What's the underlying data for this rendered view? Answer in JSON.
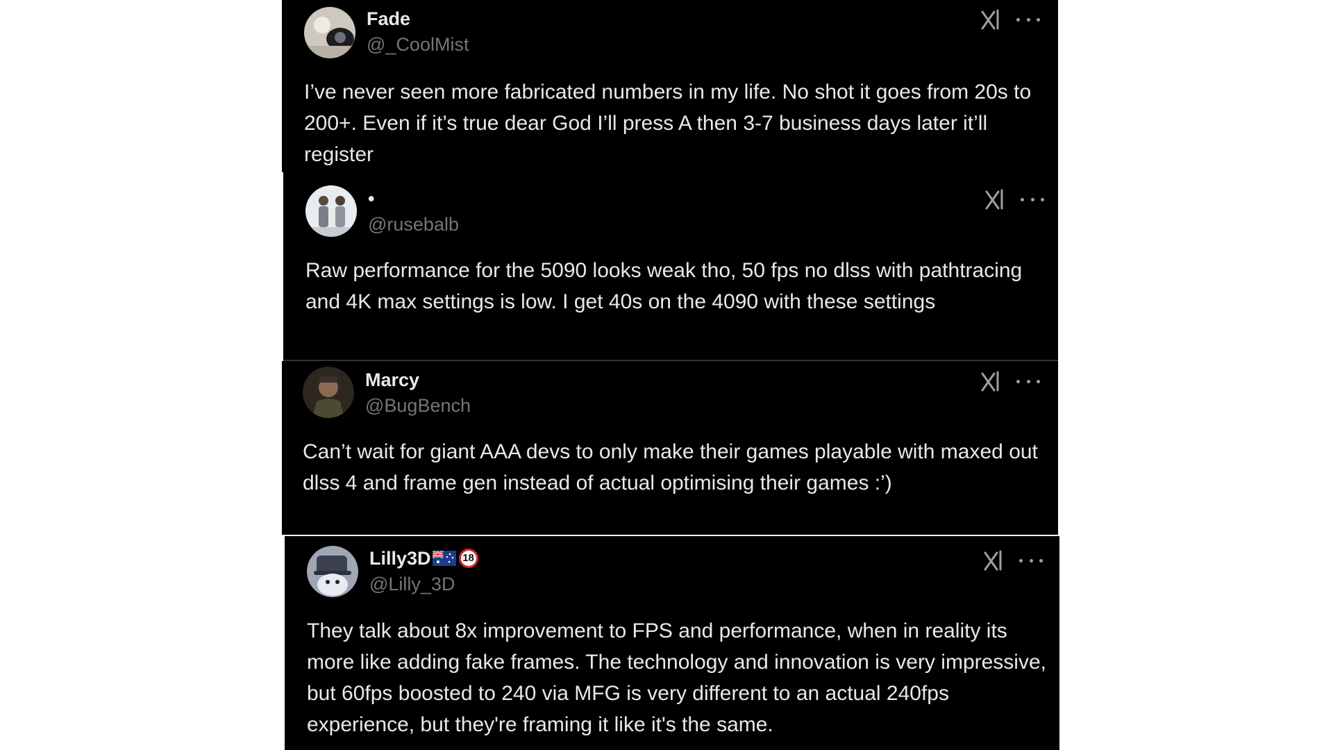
{
  "posts": [
    {
      "name": "Fade",
      "handle": "@_CoolMist",
      "text": "I’ve never seen more fabricated numbers in my life. No shot it goes from 20s to 200+. Even if it’s true dear God I’ll press A then 3-7 business days later it’ll register"
    },
    {
      "name": "•",
      "handle": "@rusebalb",
      "text": "Raw performance for the 5090 looks weak tho, 50 fps no dlss with pathtracing and 4K max settings is low. I get 40s on the 4090 with these settings"
    },
    {
      "name": "Marcy",
      "handle": "@BugBench",
      "text": "Can’t wait for giant AAA devs to only make their games playable with maxed out dlss 4 and frame gen instead of actual optimising their games :’)"
    },
    {
      "name": "Lilly3D",
      "badge_18": "18",
      "handle": "@Lilly_3D",
      "text": "They talk about 8x improvement to FPS and performance, when in reality its more like adding fake frames. The technology and innovation is very impressive, but 60fps boosted to 240 via MFG is very different to an actual 240fps experience, but they're framing it like it's the same."
    }
  ],
  "icons": {
    "grok": "grok-icon",
    "more": "more-options-icon",
    "flag": "australia-flag-icon",
    "age_badge": "age-18-badge-icon"
  },
  "colors": {
    "background": "#000000",
    "text": "#e7e9ea",
    "secondary_text": "#71767b",
    "canvas": "#ffffff"
  }
}
